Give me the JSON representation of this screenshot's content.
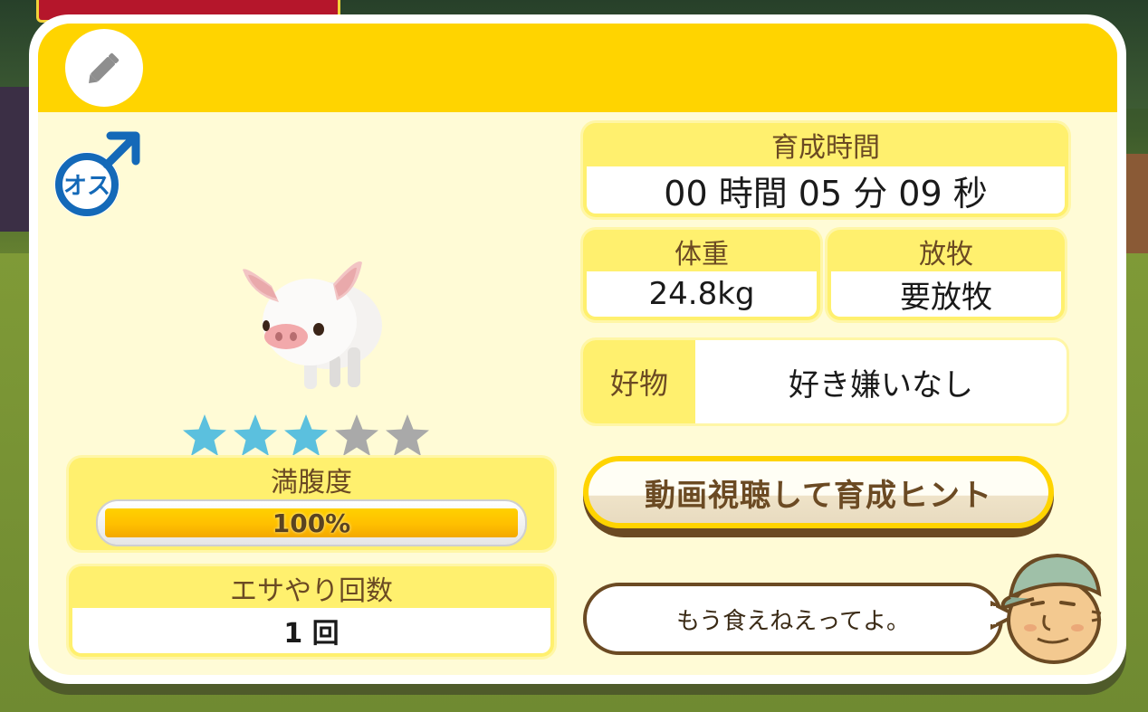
{
  "header": {
    "edit_icon": "pencil-icon"
  },
  "pet": {
    "gender_label": "オス",
    "gender_icon": "male-symbol-icon",
    "rating": 3,
    "rating_max": 5
  },
  "hunger": {
    "label": "満腹度",
    "value_text": "100%",
    "fraction": 1.0
  },
  "feed_count": {
    "label": "エサやり回数",
    "value": "1 回"
  },
  "growth_time": {
    "label": "育成時間",
    "value": "00 時間 05 分 09 秒"
  },
  "weight": {
    "label": "体重",
    "value": "24.8kg"
  },
  "grazing": {
    "label": "放牧",
    "value": "要放牧"
  },
  "favorite": {
    "label": "好物",
    "value": "好き嫌いなし"
  },
  "hint_button": {
    "label": "動画視聴して育成ヒント"
  },
  "speech": {
    "text": "もう食えねえってよ。"
  },
  "colors": {
    "header": "#ffd400",
    "label_bg": "#fff06e",
    "star_on": "#5bc0de",
    "star_off": "#a9a9a9",
    "text_brown": "#6b4a23",
    "gender_blue": "#1469b8"
  }
}
